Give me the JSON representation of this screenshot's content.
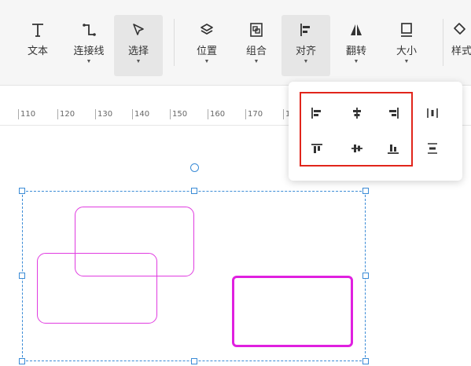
{
  "toolbar": {
    "tools": [
      {
        "label": "文本",
        "icon": "text-icon"
      },
      {
        "label": "连接线",
        "icon": "connector-icon"
      },
      {
        "label": "选择",
        "icon": "select-icon"
      },
      {
        "label": "位置",
        "icon": "layers-icon"
      },
      {
        "label": "组合",
        "icon": "group-icon"
      },
      {
        "label": "对齐",
        "icon": "align-icon"
      },
      {
        "label": "翻转",
        "icon": "flip-icon"
      },
      {
        "label": "大小",
        "icon": "size-icon"
      },
      {
        "label": "样式",
        "icon": "style-icon"
      }
    ]
  },
  "ruler": {
    "labels": [
      "110",
      "120",
      "130",
      "140",
      "150",
      "160",
      "170",
      "1"
    ]
  },
  "align_menu": {
    "options": [
      {
        "icon": "align-left-icon"
      },
      {
        "icon": "align-center-horizontal-icon"
      },
      {
        "icon": "align-right-icon"
      },
      {
        "icon": "distribute-horizontal-icon"
      },
      {
        "icon": "align-top-icon"
      },
      {
        "icon": "align-middle-vertical-icon"
      },
      {
        "icon": "align-bottom-icon"
      },
      {
        "icon": "distribute-vertical-icon"
      }
    ]
  },
  "colors": {
    "accent": "#3a8bd6",
    "shape_stroke": "#e03be0",
    "highlight": "#e1251b"
  }
}
